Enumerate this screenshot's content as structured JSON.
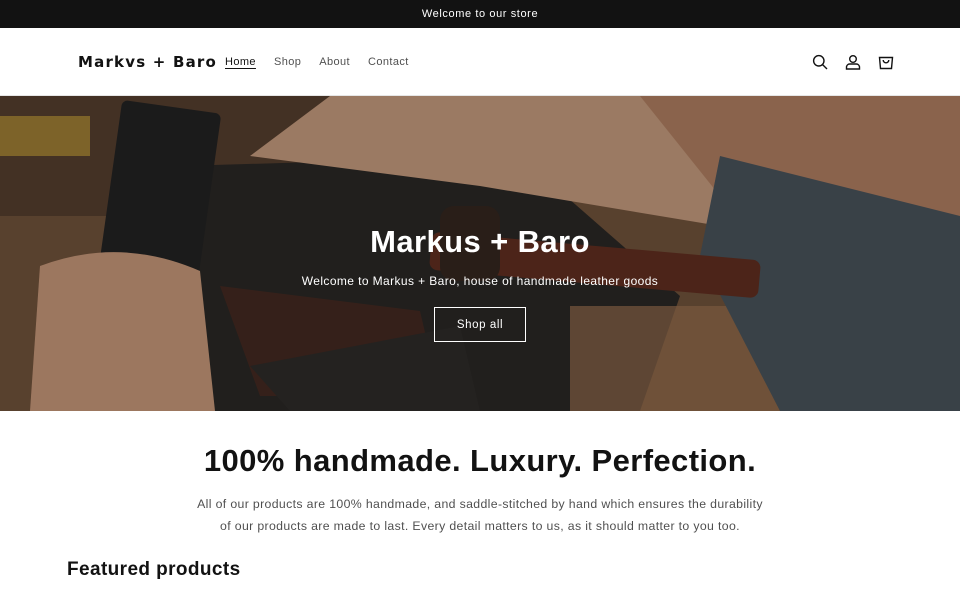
{
  "announcement": {
    "text": "Welcome to our store"
  },
  "header": {
    "logo": "Markvs + Baro",
    "nav": [
      {
        "label": "Home",
        "active": true
      },
      {
        "label": "Shop"
      },
      {
        "label": "About"
      },
      {
        "label": "Contact"
      }
    ],
    "icons": [
      "search-icon",
      "account-icon",
      "cart-icon"
    ]
  },
  "hero": {
    "title": "Markus + Baro",
    "subtitle": "Welcome to Markus + Baro, house of handmade leather goods",
    "button": "Shop all"
  },
  "rich_text": {
    "heading": "100% handmade. Luxury. Perfection.",
    "body": "All of our products are 100% handmade, and saddle-stitched by hand which ensures the durability of our products are made to last. Every detail matters to us, as it should matter to you too."
  },
  "featured": {
    "heading": "Featured products"
  }
}
